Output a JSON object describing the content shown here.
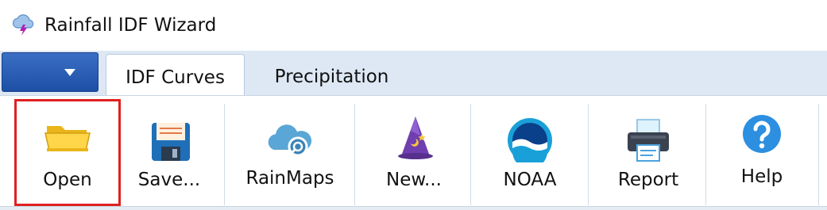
{
  "window": {
    "title": "Rainfall IDF Wizard",
    "icon": "storm-cloud-icon"
  },
  "tabs": [
    {
      "label": "IDF Curves",
      "active": true
    },
    {
      "label": "Precipitation",
      "active": false
    }
  ],
  "ribbon": {
    "buttons": [
      {
        "label": "Open",
        "icon": "folder-icon"
      },
      {
        "label": "Save...",
        "icon": "floppy-disk-icon"
      },
      {
        "label": "RainMaps",
        "icon": "cloud-search-icon"
      },
      {
        "label": "New...",
        "icon": "wizard-hat-icon"
      },
      {
        "label": "NOAA",
        "icon": "noaa-logo-icon"
      },
      {
        "label": "Report",
        "icon": "printer-icon"
      },
      {
        "label": "Help",
        "icon": "help-icon"
      }
    ],
    "highlighted": "Open"
  },
  "colors": {
    "accent": "#1e4fa6",
    "highlight": "#e02020",
    "tabbar": "#dde8f4"
  }
}
